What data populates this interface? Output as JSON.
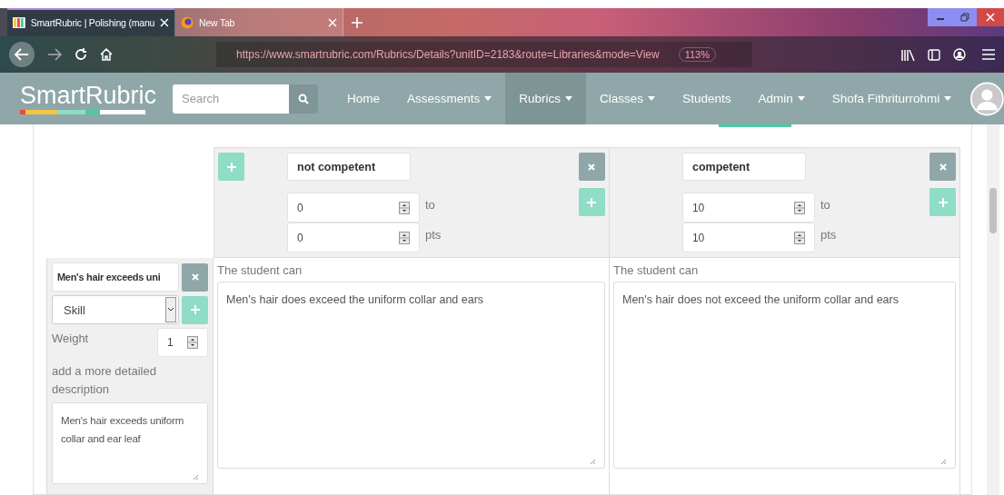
{
  "browser": {
    "tabs": [
      {
        "title": "SmartRubric | Polishing (manu",
        "selected": true
      },
      {
        "title": "New Tab",
        "selected": false
      }
    ],
    "url": "https://www.smartrubric.com/Rubrics/Details?unitID=2183&route=Libraries&mode=View",
    "zoom": "113%"
  },
  "site": {
    "logo": "SmartRubric",
    "search": {
      "placeholder": "Search"
    },
    "nav": [
      {
        "label": "Home",
        "dropdown": false,
        "selected": false
      },
      {
        "label": "Assessments",
        "dropdown": true,
        "selected": false
      },
      {
        "label": "Rubrics",
        "dropdown": true,
        "selected": true
      },
      {
        "label": "Classes",
        "dropdown": true,
        "selected": false
      },
      {
        "label": "Students",
        "dropdown": false,
        "selected": false
      },
      {
        "label": "Admin",
        "dropdown": true,
        "selected": false
      },
      {
        "label": "Shofa Fithriturrohmi",
        "dropdown": true,
        "selected": false
      }
    ]
  },
  "levels": [
    {
      "name": "not competent",
      "add_before": true,
      "range_from": "0",
      "to_label": "to",
      "points": "0",
      "points_label": "pts",
      "prefix": "The student can",
      "description": "Men's hair does exceed the uniform collar and ears"
    },
    {
      "name": "competent",
      "add_before": false,
      "range_from": "10",
      "to_label": "to",
      "points": "10",
      "points_label": "pts",
      "prefix": "The student can",
      "description": "Men's hair does not exceed the uniform collar and ears"
    }
  ],
  "criterion": {
    "title": "Men's hair exceeds uni",
    "type": "Skill",
    "weight_label": "Weight",
    "weight": "1",
    "description_label": "add a more detailed description",
    "description": "Men's hair exceeds uniform collar and ear leaf"
  }
}
